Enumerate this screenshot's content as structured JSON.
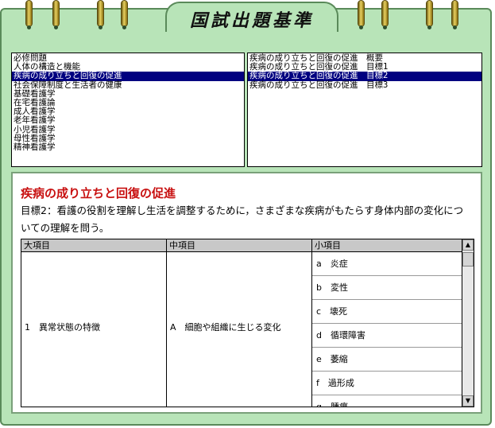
{
  "header": {
    "title": "国試出題基準"
  },
  "left_list": {
    "items": [
      {
        "label": "必修問題",
        "selected": false
      },
      {
        "label": "人体の構造と機能",
        "selected": false
      },
      {
        "label": "疾病の成り立ちと回復の促進",
        "selected": true
      },
      {
        "label": "社会保障制度と生活者の健康",
        "selected": false
      },
      {
        "label": "基礎看護学",
        "selected": false
      },
      {
        "label": "在宅看護論",
        "selected": false
      },
      {
        "label": "成人看護学",
        "selected": false
      },
      {
        "label": "老年看護学",
        "selected": false
      },
      {
        "label": "小児看護学",
        "selected": false
      },
      {
        "label": "母性看護学",
        "selected": false
      },
      {
        "label": "精神看護学",
        "selected": false
      }
    ]
  },
  "right_list": {
    "items": [
      {
        "label": "疾病の成り立ちと回復の促進　概要",
        "selected": false
      },
      {
        "label": "疾病の成り立ちと回復の促進　目標1",
        "selected": false
      },
      {
        "label": "疾病の成り立ちと回復の促進　目標2",
        "selected": true
      },
      {
        "label": "疾病の成り立ちと回復の促進　目標3",
        "selected": false
      }
    ]
  },
  "detail": {
    "title": "疾病の成り立ちと回復の促進",
    "description": "目標2：看護の役割を理解し生活を調整するために，さまざまな疾病がもたらす身体内部の変化についての理解を問う。"
  },
  "table": {
    "headers": [
      "大項目",
      "中項目",
      "小項目"
    ],
    "major": "1　異常状態の特徴",
    "middle": "A　細胞や組織に生じる変化",
    "minor": [
      "a　炎症",
      "b　変性",
      "c　壊死",
      "d　循環障害",
      "e　萎縮",
      "f　過形成",
      "g　腫瘍"
    ]
  },
  "scrollbar": {
    "up": "▲",
    "down": "▼"
  },
  "colors": {
    "background": "#b8e4b8",
    "selection": "#000080",
    "title_red": "#c81010"
  }
}
